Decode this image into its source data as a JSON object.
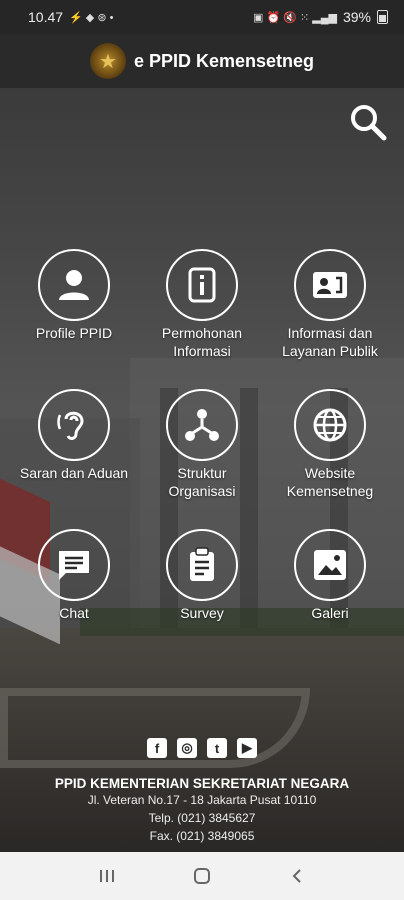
{
  "status_bar": {
    "time": "10.47",
    "battery": "39%"
  },
  "app_bar": {
    "title": "e PPID Kemensetneg"
  },
  "menu": [
    {
      "label_line1": "Profile PPID",
      "label_line2": "",
      "icon": "person-icon"
    },
    {
      "label_line1": "Permohonan",
      "label_line2": "Informasi",
      "icon": "info-icon"
    },
    {
      "label_line1": "Informasi dan",
      "label_line2": "Layanan Publik",
      "icon": "contact-card-icon"
    },
    {
      "label_line1": "Saran dan Aduan",
      "label_line2": "",
      "icon": "hearing-icon"
    },
    {
      "label_line1": "Struktur",
      "label_line2": "Organisasi",
      "icon": "org-chart-icon"
    },
    {
      "label_line1": "Website",
      "label_line2": "Kemensetneg",
      "icon": "globe-icon"
    },
    {
      "label_line1": "Chat",
      "label_line2": "",
      "icon": "chat-icon"
    },
    {
      "label_line1": "Survey",
      "label_line2": "",
      "icon": "clipboard-icon"
    },
    {
      "label_line1": "Galeri",
      "label_line2": "",
      "icon": "image-icon"
    }
  ],
  "social": [
    {
      "icon": "facebook-icon",
      "glyph": "f"
    },
    {
      "icon": "instagram-icon",
      "glyph": "◎"
    },
    {
      "icon": "twitter-icon",
      "glyph": "t"
    },
    {
      "icon": "youtube-icon",
      "glyph": "▶"
    }
  ],
  "footer": {
    "title": "PPID KEMENTERIAN SEKRETARIAT NEGARA",
    "address": "Jl. Veteran No.17 - 18 Jakarta Pusat 10110",
    "phone": "Telp. (021) 3845627",
    "fax": "Fax. (021) 3849065"
  },
  "colors": {
    "app_bar": "#2a2a2a",
    "nav_bar": "#f2f2f2",
    "icon_stroke": "#ffffff"
  }
}
